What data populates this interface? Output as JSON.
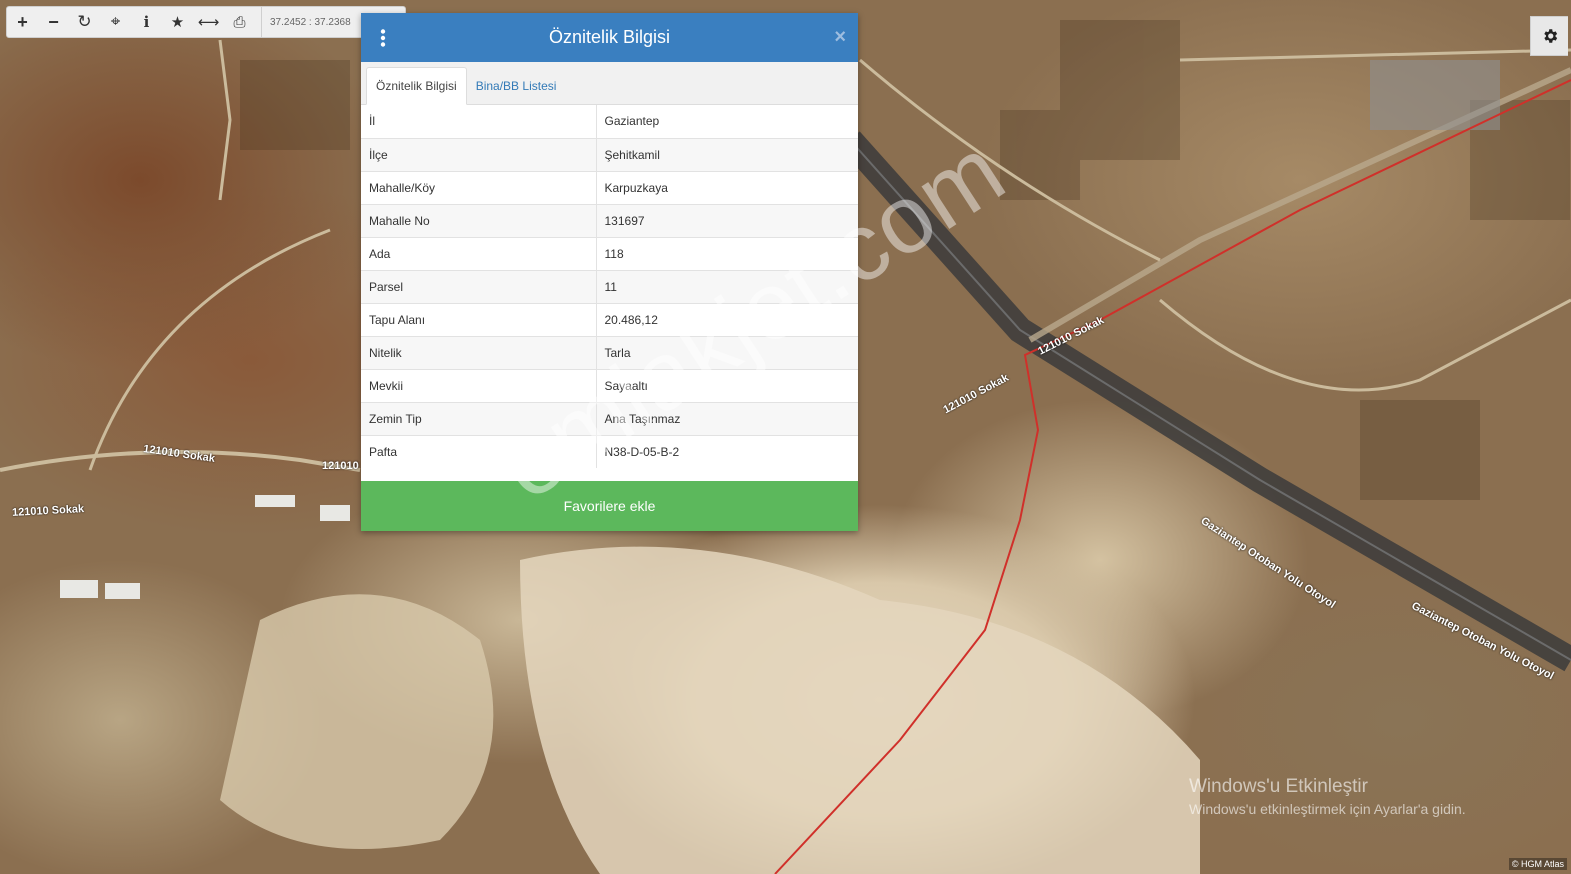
{
  "toolbar": {
    "buttons": [
      {
        "name": "zoom-in-button",
        "glyph": "+"
      },
      {
        "name": "zoom-out-button",
        "glyph": "−"
      },
      {
        "name": "refresh-button",
        "glyph": "↻"
      },
      {
        "name": "locate-button",
        "glyph": "⌖"
      },
      {
        "name": "info-button",
        "glyph": "i"
      },
      {
        "name": "favorite-button",
        "glyph": "★"
      },
      {
        "name": "measure-button",
        "glyph": "⟷"
      },
      {
        "name": "print-button",
        "glyph": "⎙"
      }
    ],
    "coordinates": "37.2452 : 37.2368"
  },
  "modal": {
    "title": "Öznitelik Bilgisi",
    "close": "×",
    "tabs": {
      "active": "Öznitelik Bilgisi",
      "second": "Bina/BB Listesi"
    },
    "rows": [
      {
        "key": "İl",
        "value": "Gaziantep"
      },
      {
        "key": "İlçe",
        "value": "Şehitkamil"
      },
      {
        "key": "Mahalle/Köy",
        "value": "Karpuzkaya"
      },
      {
        "key": "Mahalle No",
        "value": "131697"
      },
      {
        "key": "Ada",
        "value": "118"
      },
      {
        "key": "Parsel",
        "value": "11"
      },
      {
        "key": "Tapu Alanı",
        "value": "20.486,12"
      },
      {
        "key": "Nitelik",
        "value": "Tarla"
      },
      {
        "key": "Mevkii",
        "value": "Sayaaltı"
      },
      {
        "key": "Zemin Tip",
        "value": "Ana Taşınmaz"
      },
      {
        "key": "Pafta",
        "value": "N38-D-05-B-2"
      }
    ],
    "favorite_button": "Favorilere ekle"
  },
  "map": {
    "road_labels": [
      "121010 Sokak",
      "121010 Sokak",
      "121010 Sokak",
      "121010 Sokak",
      "121010 Sokak",
      "Gaziantep Otoban Yolu Otoyol",
      "Gaziantep Otoban Yolu Otoyol"
    ],
    "boundary_color": "#d0302a",
    "credit": "© HGM Atlas"
  },
  "watermark": "emlakjet.com",
  "windows_activation": {
    "title": "Windows'u Etkinleştir",
    "subtitle": "Windows'u etkinleştirmek için Ayarlar'a gidin."
  }
}
